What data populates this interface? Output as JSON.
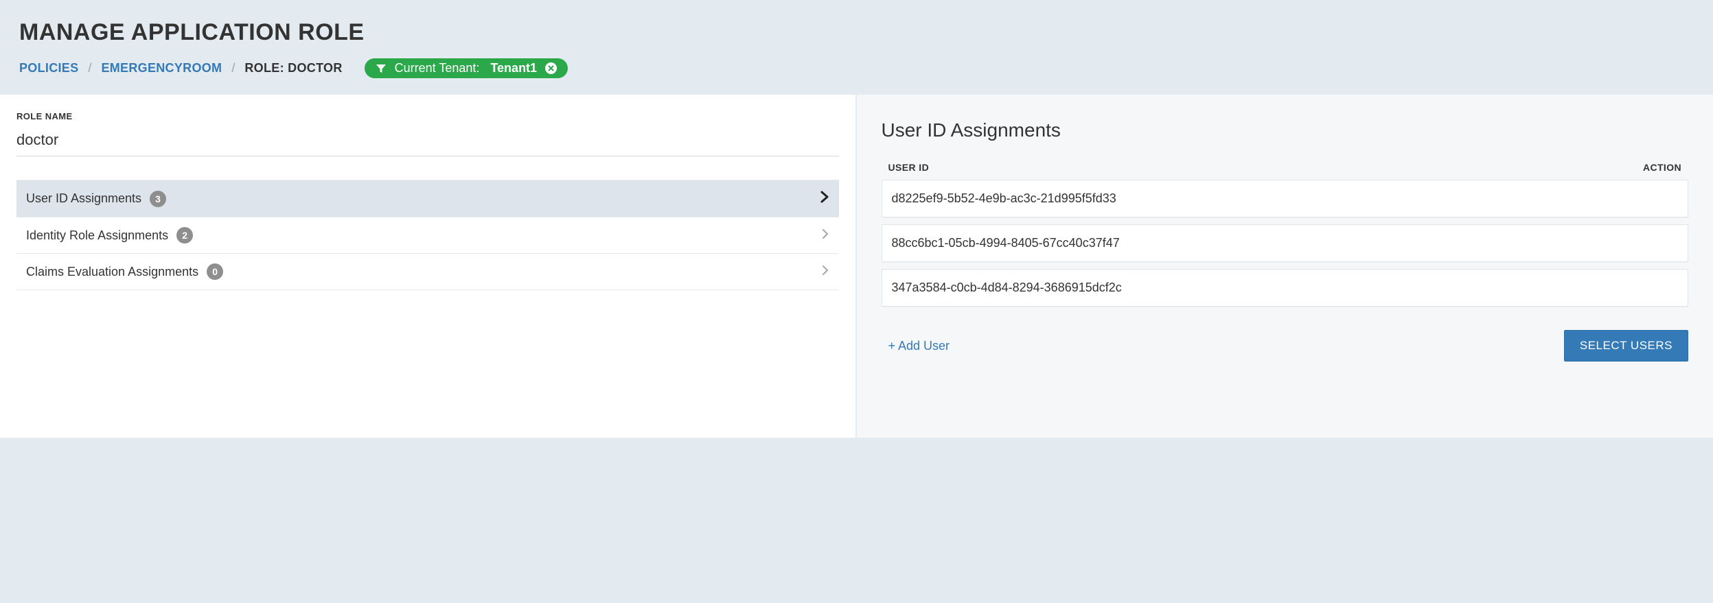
{
  "header": {
    "title": "MANAGE APPLICATION ROLE",
    "breadcrumb": {
      "policies": "POLICIES",
      "app": "EMERGENCYROOM",
      "current": "ROLE: DOCTOR"
    },
    "tenant": {
      "label": "Current Tenant:",
      "name": "Tenant1"
    }
  },
  "left": {
    "role_name_label": "ROLE NAME",
    "role_name_value": "doctor",
    "nav": [
      {
        "label": "User ID Assignments",
        "count": "3",
        "active": true
      },
      {
        "label": "Identity Role Assignments",
        "count": "2",
        "active": false
      },
      {
        "label": "Claims Evaluation Assignments",
        "count": "0",
        "active": false
      }
    ]
  },
  "right": {
    "title": "User ID Assignments",
    "table": {
      "col_user_id": "USER ID",
      "col_action": "ACTION",
      "rows": [
        "d8225ef9-5b52-4e9b-ac3c-21d995f5fd33",
        "88cc6bc1-05cb-4994-8405-67cc40c37f47",
        "347a3584-c0cb-4d84-8294-3686915dcf2c"
      ]
    },
    "add_user_label": "+ Add User",
    "select_users_label": "SELECT USERS"
  }
}
